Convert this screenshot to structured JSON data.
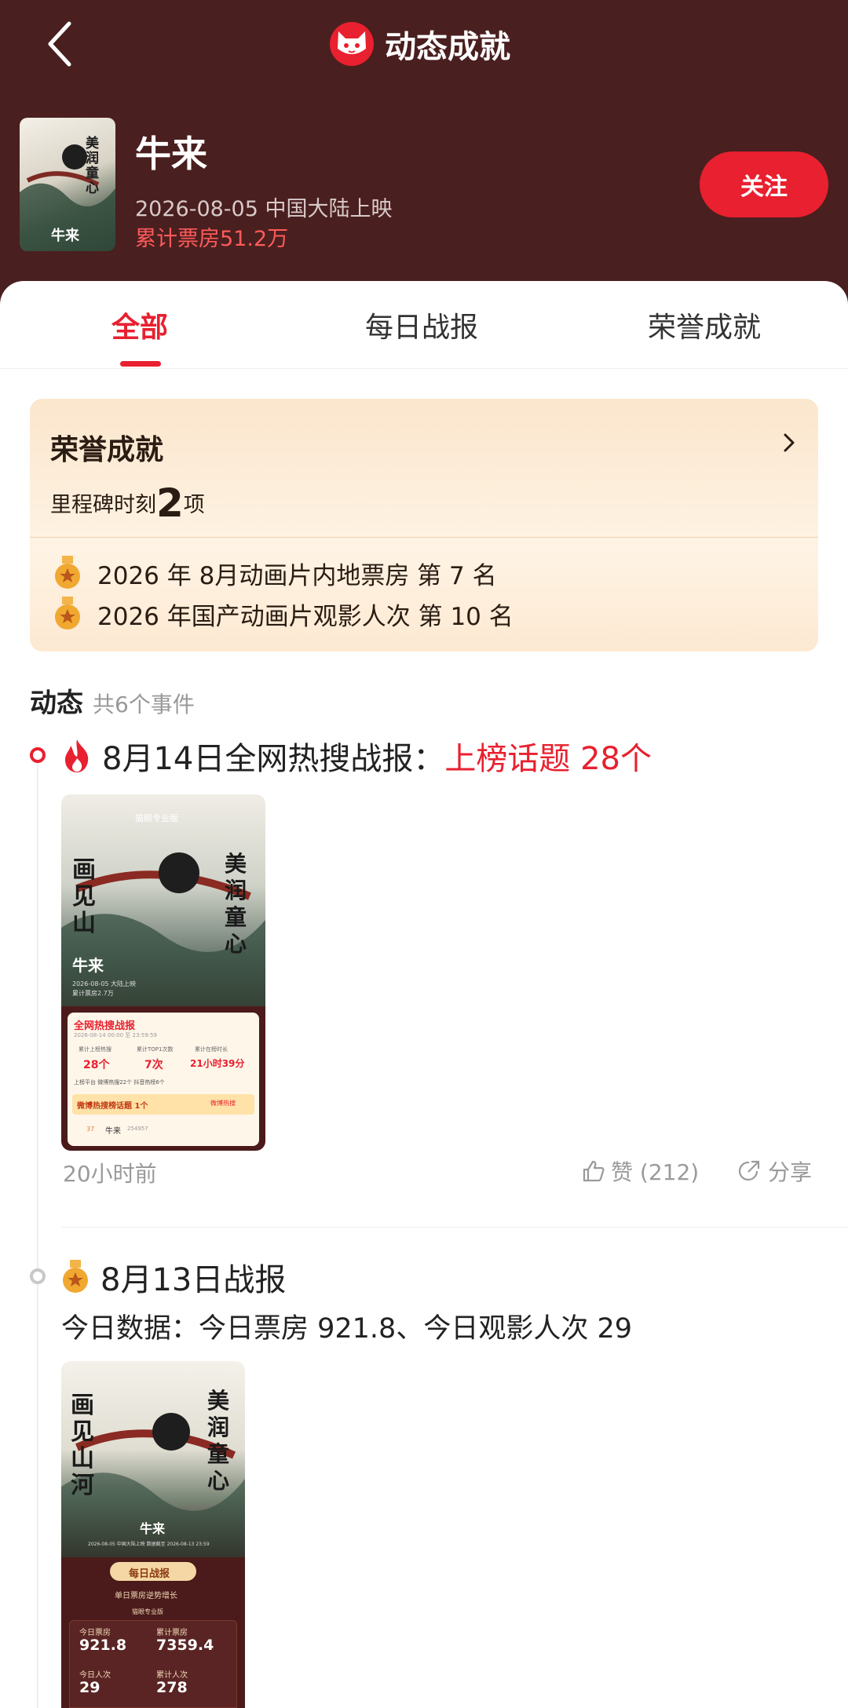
{
  "nav": {
    "title": "动态成就"
  },
  "movie": {
    "title": "牛来",
    "release": "2026-08-05 中国大陆上映",
    "box_office": "累计票房51.2万",
    "follow_label": "关注",
    "poster_title": "画见山",
    "poster_slogan": "美润童心",
    "poster_name": "牛来"
  },
  "tabs": [
    {
      "label": "全部",
      "active": true
    },
    {
      "label": "每日战报",
      "active": false
    },
    {
      "label": "荣誉成就",
      "active": false
    }
  ],
  "honor": {
    "title": "荣誉成就",
    "milestone_prefix": "里程碑时刻",
    "milestone_count": "2",
    "milestone_suffix": "项",
    "items": [
      "2026 年 8月动画片内地票房  第 7 名",
      "2026 年国产动画片观影人次  第 10 名"
    ]
  },
  "dynamics": {
    "title": "动态",
    "count": "共6个事件"
  },
  "event1": {
    "title": "8月14日全网热搜战报：",
    "highlight": "上榜话题 28个",
    "time": "20小时前",
    "like_label": "赞 (212)",
    "share_label": "分享",
    "card": {
      "brand": "猫眼专业版",
      "title_left": "画见山",
      "title_right": "美润童心",
      "name": "牛来",
      "meta1": "2026-08-05 大陆上映",
      "meta2": "累计票房2.7万",
      "report_title": "全网热搜战报",
      "report_time": "2026-08-14 00:00 至 23:59:59",
      "stat_labels": [
        "累计上榜热搜",
        "累计TOP1次数",
        "累计在榜时长"
      ],
      "stat_values": [
        "28个",
        "7次",
        "21小时39分"
      ],
      "platform": "上榜平台  微博热搜22个  抖音热榜6个",
      "weibo": "微博热搜榜话题 1个",
      "weibo_tag": "微博热搜",
      "row_rank": "37",
      "row_name": "牛来",
      "row_val": "254957"
    }
  },
  "event2": {
    "title": "8月13日战报",
    "sub": "今日数据：今日票房 921.8、今日观影人次 29",
    "card": {
      "title_left": "画见山河",
      "title_right": "美润童心",
      "name": "牛来",
      "meta": "2026-08-05 中国大陆上映   数据截至 2026-08-13 23:59",
      "badge": "每日战报",
      "caption": "单日票房逆势增长",
      "brand": "猫眼专业版",
      "labels": [
        "今日票房",
        "累计票房",
        "今日人次",
        "累计人次"
      ],
      "values": [
        "921.8",
        "7359.4",
        "29",
        "278"
      ]
    }
  }
}
